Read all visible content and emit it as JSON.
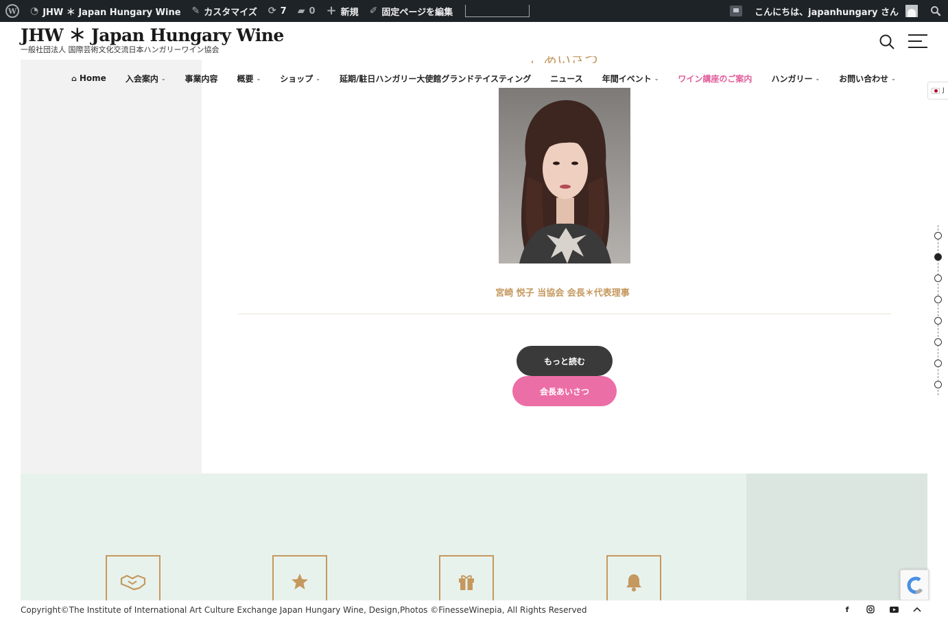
{
  "adminbar": {
    "site_name": "JHW ＊ Japan Hungary Wine",
    "customize": "カスタマイズ",
    "updates_count": "7",
    "comments_count": "0",
    "new": "新規",
    "edit_page": "固定ページを編集",
    "greeting": "こんにちは、japanhungary さん"
  },
  "header": {
    "title": "JHW ＊ Japan Hungary Wine",
    "description": "一般社団法人 国際芸術文化交流日本ハンガリーワイン協会"
  },
  "nav": {
    "items": [
      {
        "label": "Home"
      },
      {
        "label": "入会案内"
      },
      {
        "label": "事業内容"
      },
      {
        "label": "概要"
      },
      {
        "label": "ショップ"
      },
      {
        "label": "延期/駐日ハンガリー大使館グランドテイスティング"
      },
      {
        "label": "ニュース"
      },
      {
        "label": "年間イベント"
      },
      {
        "label": "ワイン講座のご案内"
      },
      {
        "label": "ハンガリー"
      },
      {
        "label": "お問い合わせ"
      }
    ],
    "active_color": "#e05c9b",
    "language": "J"
  },
  "greeting_section": {
    "heading": "ごあいさつ",
    "portrait_caption": "宮崎 悦子 当協会 会長＊代表理事",
    "more_button": "もっと読む",
    "greeting_button": "会長あいさつ",
    "accent_color": "#c4985e",
    "pink_color": "#ec6ea6"
  },
  "pager": {
    "count": 8,
    "active_index": 1
  },
  "features": {
    "icons": [
      "handshake-icon",
      "star-icon",
      "gift-icon",
      "bell-icon"
    ]
  },
  "footer": {
    "copyright": "Copyright©The Institute of International Art Culture Exchange Japan Hungary Wine, Design,Photos ©FinesseWinepia, All Rights Reserved",
    "social": [
      "facebook-icon",
      "instagram-icon",
      "youtube-icon",
      "scroll-top-icon"
    ]
  }
}
